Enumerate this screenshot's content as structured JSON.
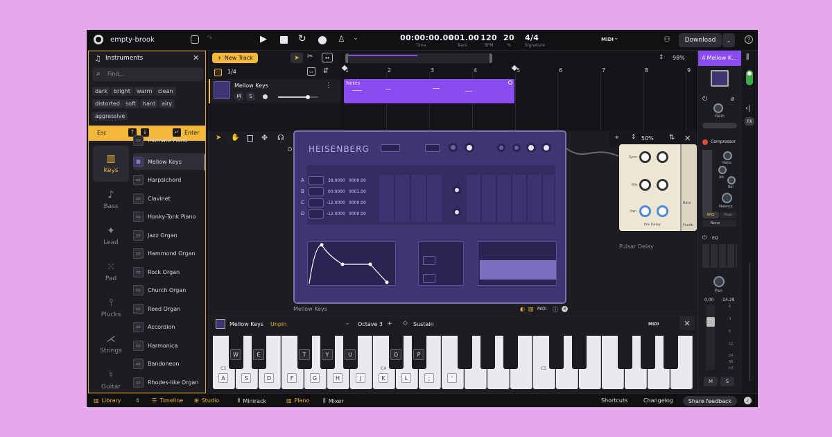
{
  "project": {
    "name": "empty-brook"
  },
  "transport": {
    "time": "00:00:00.00",
    "time_label": "Time",
    "bars": "001.00",
    "bars_label": "Bars",
    "bpm": "120",
    "bpm_label": "BPM",
    "percent": "20",
    "percent_label": "%",
    "signature": "4/4",
    "signature_label": "Signature"
  },
  "header": {
    "midi": "MIDI",
    "download": "Download"
  },
  "library": {
    "title": "Instruments",
    "search_placeholder": "Find...",
    "tags": [
      "dark",
      "bright",
      "warm",
      "clean",
      "distorted",
      "soft",
      "hard",
      "airy",
      "aggressive"
    ],
    "esc": "Esc",
    "enter": "Enter",
    "categories": [
      "Keys",
      "Bass",
      "Lead",
      "Pad",
      "Plucks",
      "Strings",
      "Guitar"
    ],
    "instruments": [
      "Intimate Piano",
      "Mellow Keys",
      "Harpsichord",
      "Clavinet",
      "Honky-Tonk Piano",
      "Jazz Organ",
      "Hammond Organ",
      "Rock Organ",
      "Church Organ",
      "Reed Organ",
      "Accordion",
      "Harmonica",
      "Bandoneon",
      "Rhodes-like Organ"
    ]
  },
  "timeline": {
    "new_track": "New Track",
    "zoom": "98%",
    "quantize": "1/4",
    "track_name": "Mellow Keys",
    "mute": "M",
    "solo": "S",
    "clip_name": "Notes",
    "bars": [
      "1",
      "2",
      "3",
      "4",
      "5",
      "6",
      "7",
      "8",
      "9"
    ]
  },
  "inspector": {
    "track_tab": "4  Mellow K...",
    "fx": "FX",
    "gain": "Gain",
    "compressor": "Compressor",
    "ratio": "Ratio",
    "att": "Att",
    "rel": "Rel",
    "makeup": "Makeup",
    "rms": "RMS",
    "peak": "Peak",
    "none": "None",
    "eq": "EQ",
    "pan": "Pan",
    "vol_left": "0.00",
    "vol_right": "-14.29",
    "mute": "M",
    "solo": "S",
    "meter_ticks": [
      "6",
      "0",
      "6",
      "12",
      "24",
      "36",
      "inf"
    ]
  },
  "studio": {
    "zoom": "50%",
    "synth_name": "HEISENBERG",
    "synth_label": "Mellow Keys",
    "delay_name": "Pulsar Delay",
    "delay_sync": "Sync",
    "delay_mix": "Mix",
    "delay_pan": "Pan",
    "pre_delay": "Pre Delay",
    "rate": "Rate",
    "feedback": "Feedb",
    "osc_rows": [
      "A",
      "B",
      "C",
      "D"
    ],
    "osc_values": [
      [
        "38.0000",
        "0000.00"
      ],
      [
        "00.0000",
        "0001.00"
      ],
      [
        "-12.0000",
        "0000.00"
      ],
      [
        "-12.0000",
        "0000.00"
      ]
    ]
  },
  "piano": {
    "instrument": "Mellow Keys",
    "unpin": "Unpin",
    "octave": "Octave 3",
    "sustain": "Sustain",
    "midi": "MIDI",
    "upper_labels": [
      "W",
      "E",
      "T",
      "Y",
      "U",
      "O",
      "P"
    ],
    "lower_labels": [
      "A",
      "S",
      "D",
      "F",
      "G",
      "H",
      "J",
      "K",
      "L",
      ";",
      "'"
    ],
    "octave_labels": [
      "C3",
      "C4",
      "C5"
    ]
  },
  "bottom": {
    "library": "Library",
    "timeline": "Timeline",
    "studio": "Studio",
    "minirack": "Minirack",
    "piano": "Piano",
    "mixer": "Mixer",
    "shortcuts": "Shortcuts",
    "changelog": "Changelog",
    "feedback": "Share feedback"
  },
  "colors": {
    "accent": "#f3b73a",
    "purple": "#8a4bf0",
    "synth": "#3f3572"
  }
}
